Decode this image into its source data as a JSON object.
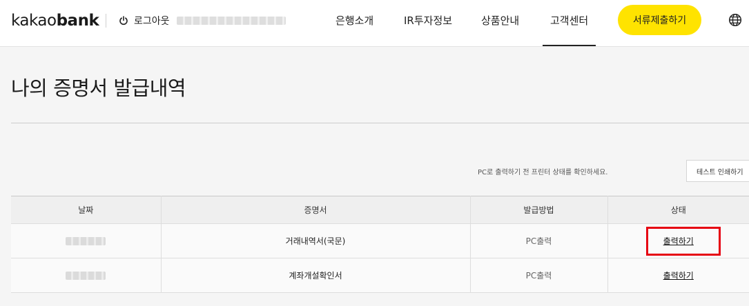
{
  "header": {
    "logo_light": "kakao",
    "logo_bold": "bank",
    "logout_label": "로그아웃",
    "icon_logout": "power-icon",
    "icon_lang": "globe-icon",
    "nav": [
      {
        "label": "은행소개"
      },
      {
        "label": "IR투자정보"
      },
      {
        "label": "상품안내"
      },
      {
        "label": "고객센터"
      }
    ],
    "active_nav": "고객센터",
    "cta_label": "서류제출하기",
    "cta_color": "#ffe300"
  },
  "page": {
    "title": "나의 증명서 발급내역",
    "notice": "PC로 출력하기 전 프린터 상태를 확인하세요.",
    "test_print_label": "테스트 인쇄하기"
  },
  "table": {
    "headers": [
      "날짜",
      "증명서",
      "발급방법",
      "상태"
    ],
    "rows": [
      {
        "certificate": "거래내역서(국문)",
        "method": "PC출력",
        "status": "출력하기",
        "highlighted": true
      },
      {
        "certificate": "계좌개설확인서",
        "method": "PC출력",
        "status": "출력하기",
        "highlighted": false
      }
    ]
  },
  "colors": {
    "highlight": "#e60012",
    "accent": "#ffe300"
  }
}
